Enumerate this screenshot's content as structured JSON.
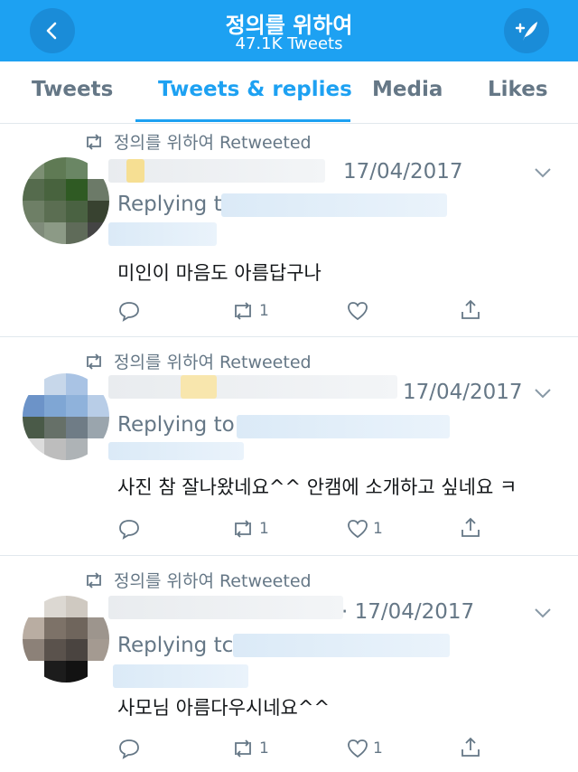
{
  "header": {
    "title": "정의를 위하여",
    "subtitle": "47.1K Tweets",
    "back_icon": "back-arrow-icon",
    "compose_icon": "compose-icon"
  },
  "tabs": [
    {
      "label": "Tweets",
      "active": false
    },
    {
      "label": "Tweets & replies",
      "active": true
    },
    {
      "label": "Media",
      "active": false
    },
    {
      "label": "Likes",
      "active": false
    }
  ],
  "colors": {
    "brand": "#1da1f2",
    "header_button": "#1a8cd8",
    "muted": "#657786",
    "text": "#14171a"
  },
  "tweets": [
    {
      "retweeted_by": "정의를 위하여 Retweeted",
      "date": "17/04/2017",
      "replying": "Replying t",
      "text": "미인이 마음도 아름답구나",
      "retweets": "1",
      "likes": ""
    },
    {
      "retweeted_by": "정의를 위하여 Retweeted",
      "date": "17/04/2017",
      "replying": "Replying to",
      "text": "사진 참 잘나왔네요^^ 안캠에 소개하고 싶네요 ㅋ",
      "retweets": "1",
      "likes": "1"
    },
    {
      "retweeted_by": "정의를 위하여 Retweeted",
      "date": "· 17/04/2017",
      "replying": "Replying tc",
      "text": "사모님 아름다우시네요^^",
      "retweets": "1",
      "likes": "1"
    }
  ]
}
